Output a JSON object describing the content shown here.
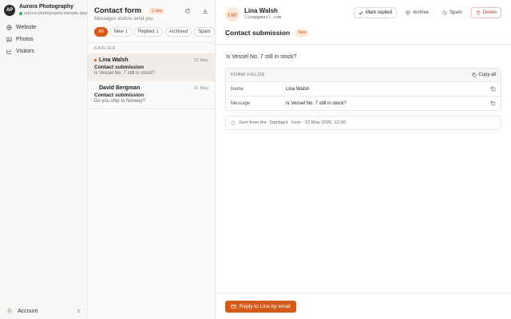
{
  "sidebar": {
    "avatar_initials": "AP",
    "brand_name": "Aurora Photography",
    "brand_url": "aurora-photography.sitespin.app",
    "items": [
      {
        "label": "Website",
        "icon": "globe-icon"
      },
      {
        "label": "Photos",
        "icon": "image-icon"
      },
      {
        "label": "Visitors",
        "icon": "chart-icon"
      }
    ],
    "account_initial": "L",
    "account_label": "Account"
  },
  "list": {
    "title": "Contact form",
    "new_badge": "1 new",
    "subtitle": "Messages visitors send you",
    "filters": [
      {
        "label": "All",
        "count": ""
      },
      {
        "label": "New",
        "count": "1"
      },
      {
        "label": "Replied",
        "count": "1"
      },
      {
        "label": "Archived",
        "count": ""
      },
      {
        "label": "Spam",
        "count": ""
      }
    ],
    "section": "EARLIER",
    "messages": [
      {
        "name": "Lina Walsh",
        "date": "22 May",
        "subject": "Contact submission",
        "preview": "Is Vessel No. 7 still in stock?",
        "unread": true
      },
      {
        "name": "David Bergman",
        "date": "21 May",
        "subject": "Contact submission",
        "preview": "Do you ship to Norway?",
        "unread": false
      }
    ]
  },
  "detail": {
    "initials": "LW",
    "name": "Lina Walsh",
    "email": "lina@gmail.com",
    "actions": {
      "mark_replied": "Mark replied",
      "archive": "Archive",
      "spam": "Spam",
      "delete": "Delete"
    },
    "subject": "Contact submission",
    "status": "New",
    "body": "Is Vessel No. 7 still in stock?",
    "fields_title": "FORM FIELDS",
    "copy_all": "Copy all",
    "fields": [
      {
        "label": "Name",
        "value": "Lina Walsh"
      },
      {
        "label": "Message",
        "value": "Is Vessel No. 7 still in stock?"
      }
    ],
    "meta": {
      "prefix": "Sent from the",
      "form": "Contact",
      "suffix": "form · 22 May 2026, 12:00"
    },
    "reply_label": "Reply to Lina by email"
  },
  "colors": {
    "accent": "#d35a1a",
    "accent_soft": "#fde9d9",
    "danger": "#c93a2a",
    "online": "#3aa55d"
  }
}
